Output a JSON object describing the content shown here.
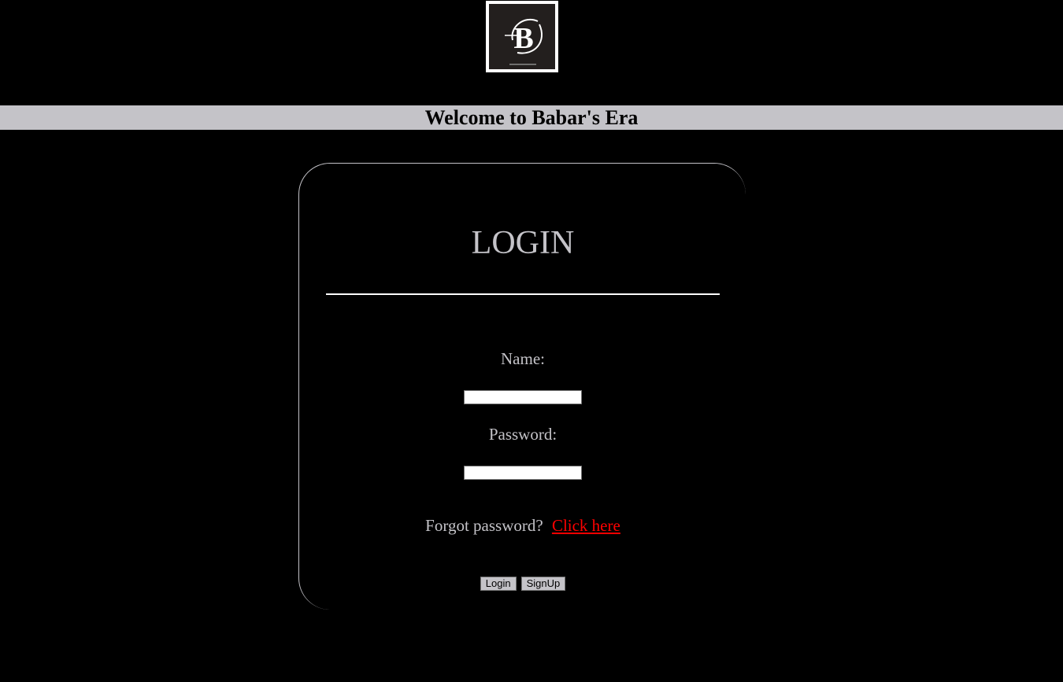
{
  "header": {
    "logo_icon": "babar-logo-icon",
    "logo_letter": "B",
    "banner_title": "Welcome to Babar's Era"
  },
  "login": {
    "title": "LOGIN",
    "name_label": "Name:",
    "name_value": "",
    "password_label": "Password:",
    "password_value": "",
    "forgot_text": "Forgot password?",
    "forgot_link": "Click here",
    "login_button": "Login",
    "signup_button": "SignUp"
  },
  "colors": {
    "background": "#000000",
    "banner": "#c4c3c8",
    "text": "#c4c3c8",
    "link": "#ff0000",
    "logo_bg": "#231f1e"
  }
}
